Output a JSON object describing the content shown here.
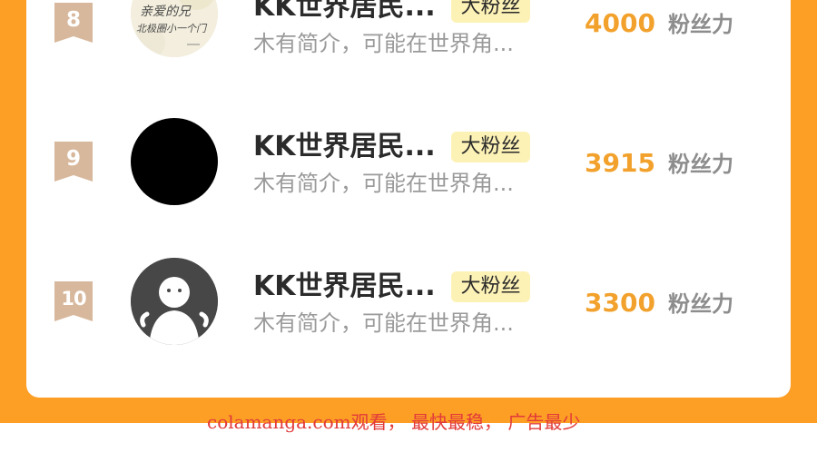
{
  "rows": [
    {
      "rank": "8",
      "name": "KK世界居民...",
      "badge": "大粉丝",
      "bio": "木有简介，可能在世界角...",
      "score": "4000",
      "score_label": "粉丝力",
      "avatar": "calligraphy-avatar",
      "avatar_text": [
        "亲爱的兄",
        "北极圈小一个门"
      ]
    },
    {
      "rank": "9",
      "name": "KK世界居民...",
      "badge": "大粉丝",
      "bio": "木有简介，可能在世界角...",
      "score": "3915",
      "score_label": "粉丝力",
      "avatar": "black-avatar"
    },
    {
      "rank": "10",
      "name": "KK世界居民...",
      "badge": "大粉丝",
      "bio": "木有简介，可能在世界角...",
      "score": "3300",
      "score_label": "粉丝力",
      "avatar": "default-avatar"
    }
  ],
  "watermark": "colamanga.com观看， 最快最稳， 广告最少",
  "colors": {
    "background": "#fd9e25",
    "card": "#ffffff",
    "rank_badge": "#d7b89c",
    "fan_badge": "#fdf2b6",
    "score": "#f2a12c"
  }
}
